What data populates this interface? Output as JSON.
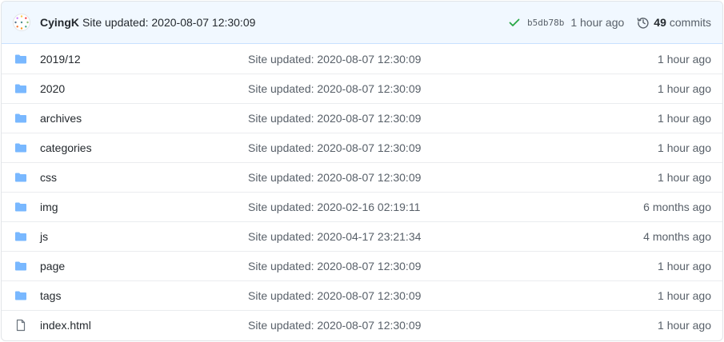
{
  "latest_commit": {
    "author": "CyingK",
    "message": "Site updated: 2020-08-07 12:30:09",
    "sha": "b5db78b",
    "age": "1 hour ago",
    "commits_count": "49",
    "commits_label": "commits"
  },
  "colors": {
    "folder": "#79b8ff",
    "check": "#28a745",
    "header_bg": "#f1f8ff"
  },
  "files": [
    {
      "type": "folder",
      "icon": "folder-icon",
      "name": "2019/12",
      "message": "Site updated: 2020-08-07 12:30:09",
      "age": "1 hour ago"
    },
    {
      "type": "folder",
      "icon": "folder-icon",
      "name": "2020",
      "message": "Site updated: 2020-08-07 12:30:09",
      "age": "1 hour ago"
    },
    {
      "type": "folder",
      "icon": "folder-icon",
      "name": "archives",
      "message": "Site updated: 2020-08-07 12:30:09",
      "age": "1 hour ago"
    },
    {
      "type": "folder",
      "icon": "folder-icon",
      "name": "categories",
      "message": "Site updated: 2020-08-07 12:30:09",
      "age": "1 hour ago"
    },
    {
      "type": "folder",
      "icon": "folder-icon",
      "name": "css",
      "message": "Site updated: 2020-08-07 12:30:09",
      "age": "1 hour ago"
    },
    {
      "type": "folder",
      "icon": "folder-icon",
      "name": "img",
      "message": "Site updated: 2020-02-16 02:19:11",
      "age": "6 months ago"
    },
    {
      "type": "folder",
      "icon": "folder-icon",
      "name": "js",
      "message": "Site updated: 2020-04-17 23:21:34",
      "age": "4 months ago"
    },
    {
      "type": "folder",
      "icon": "folder-icon",
      "name": "page",
      "message": "Site updated: 2020-08-07 12:30:09",
      "age": "1 hour ago"
    },
    {
      "type": "folder",
      "icon": "folder-icon",
      "name": "tags",
      "message": "Site updated: 2020-08-07 12:30:09",
      "age": "1 hour ago"
    },
    {
      "type": "file",
      "icon": "file-icon",
      "name": "index.html",
      "message": "Site updated: 2020-08-07 12:30:09",
      "age": "1 hour ago"
    }
  ]
}
